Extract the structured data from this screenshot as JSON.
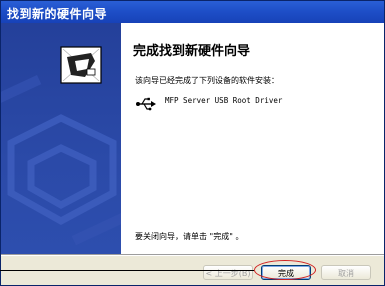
{
  "window": {
    "title": "找到新的硬件向导"
  },
  "content": {
    "heading": "完成找到新硬件向导",
    "description": "该向导已经完成了下列设备的软件安装：",
    "device_icon": "usb-icon",
    "device_name": "MFP Server USB Root Driver",
    "finish_instruction": "要关闭向导，请单击 \"完成\" 。"
  },
  "buttons": {
    "back_label": "< 上一步(B)",
    "finish_label": "完成",
    "cancel_label": "取消"
  },
  "colors": {
    "titlebar": "#1e4fc8",
    "left_panel": "#2b4aa8",
    "highlight_circle": "#d02020"
  }
}
